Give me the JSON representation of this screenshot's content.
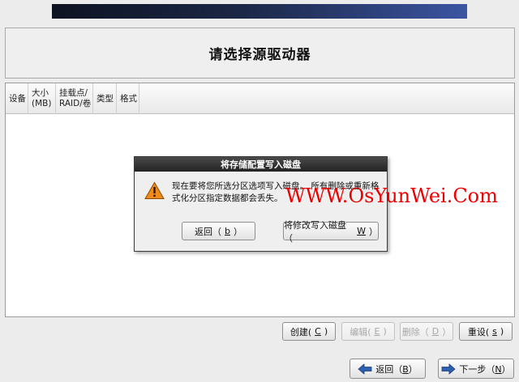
{
  "page": {
    "title": "请选择源驱动器"
  },
  "table": {
    "columns": [
      "设备",
      "大小\n(MB)",
      "挂载点/\nRAID/卷",
      "类型",
      "格式"
    ],
    "rows": []
  },
  "dialog": {
    "title": "将存储配置写入磁盘",
    "message": "现在要将您所选分区选项写入磁盘。 所有删除或重新格式化分区指定数据都会丢失。",
    "icon": "warning-icon",
    "back_button": {
      "label": "返回（",
      "key": "b",
      "suffix": "）"
    },
    "write_button": {
      "label": "将修改写入磁盘（",
      "key": "W",
      "suffix": "）"
    }
  },
  "watermark": "WWW.OsYunWei.Com",
  "toolbar": {
    "create": {
      "label": "创建(",
      "key": "C",
      "suffix": ")"
    },
    "edit": {
      "label": "编辑(",
      "key": "E",
      "suffix": ")"
    },
    "delete": {
      "label": "删除（",
      "key": "D",
      "suffix": "）"
    },
    "reset": {
      "label": "重设(",
      "key": "s",
      "suffix": ")"
    }
  },
  "nav": {
    "back": {
      "label": "返回（",
      "key": "B",
      "suffix": "）",
      "icon": "arrow-left-icon"
    },
    "next": {
      "label": "下一步（",
      "key": "N",
      "suffix": "）",
      "icon": "arrow-right-icon"
    }
  },
  "colors": {
    "banner_dark": "#0e1322",
    "banner_light": "#3c55a2",
    "watermark": "#ee0000",
    "warning": "#f08a1c",
    "nav_arrow": "#2c5fb0"
  }
}
